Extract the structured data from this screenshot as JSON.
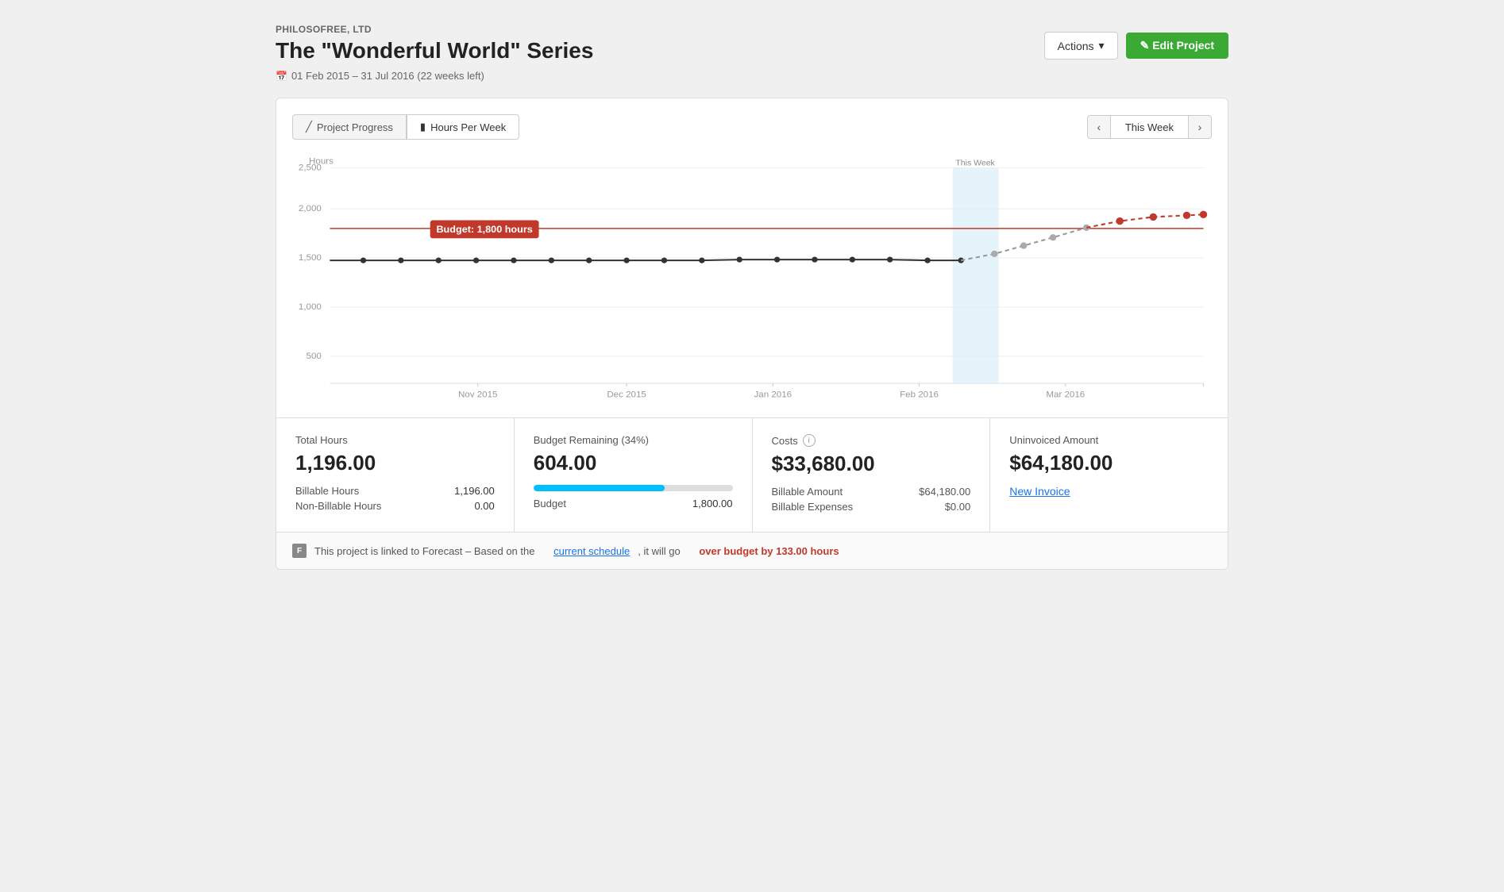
{
  "company": "PHILOSOFREE, LTD",
  "project_title": "The \"Wonderful World\" Series",
  "date_range": "01 Feb 2015 – 31 Jul 2016 (22 weeks left)",
  "header": {
    "actions_label": "Actions",
    "edit_label": "✎ Edit Project"
  },
  "tabs": {
    "left": [
      {
        "id": "project-progress",
        "label": "Project Progress",
        "active": false
      },
      {
        "id": "hours-per-week",
        "label": "Hours Per Week",
        "active": true
      }
    ],
    "nav": {
      "prev": "‹",
      "current": "This Week",
      "next": "›"
    }
  },
  "chart": {
    "y_axis_label": "Hours",
    "y_ticks": [
      "2,500",
      "2,000",
      "1,500",
      "1,000",
      "500"
    ],
    "x_labels": [
      "Nov 2015",
      "Dec 2015",
      "Jan 2016",
      "Feb 2016",
      "Mar 2016"
    ],
    "budget_label": "Budget: 1,800 hours",
    "this_week_label": "This Week"
  },
  "stats": {
    "total_hours": {
      "label": "Total Hours",
      "value": "1,196.00",
      "billable_label": "Billable Hours",
      "billable_value": "1,196.00",
      "nonbillable_label": "Non-Billable Hours",
      "nonbillable_value": "0.00"
    },
    "budget_remaining": {
      "label": "Budget Remaining (34%)",
      "value": "604.00",
      "budget_label": "Budget",
      "budget_value": "1,800.00",
      "progress_pct": 66
    },
    "costs": {
      "label": "Costs",
      "value": "$33,680.00",
      "billable_amount_label": "Billable Amount",
      "billable_amount_value": "$64,180.00",
      "billable_expenses_label": "Billable Expenses",
      "billable_expenses_value": "$0.00"
    },
    "uninvoiced": {
      "label": "Uninvoiced Amount",
      "value": "$64,180.00",
      "new_invoice_label": "New Invoice"
    }
  },
  "forecast": {
    "icon": "F",
    "text_before": "This project is linked to Forecast – Based on the",
    "link_text": "current schedule",
    "text_after": ", it will go",
    "over_budget_text": "over budget by 133.00 hours"
  }
}
